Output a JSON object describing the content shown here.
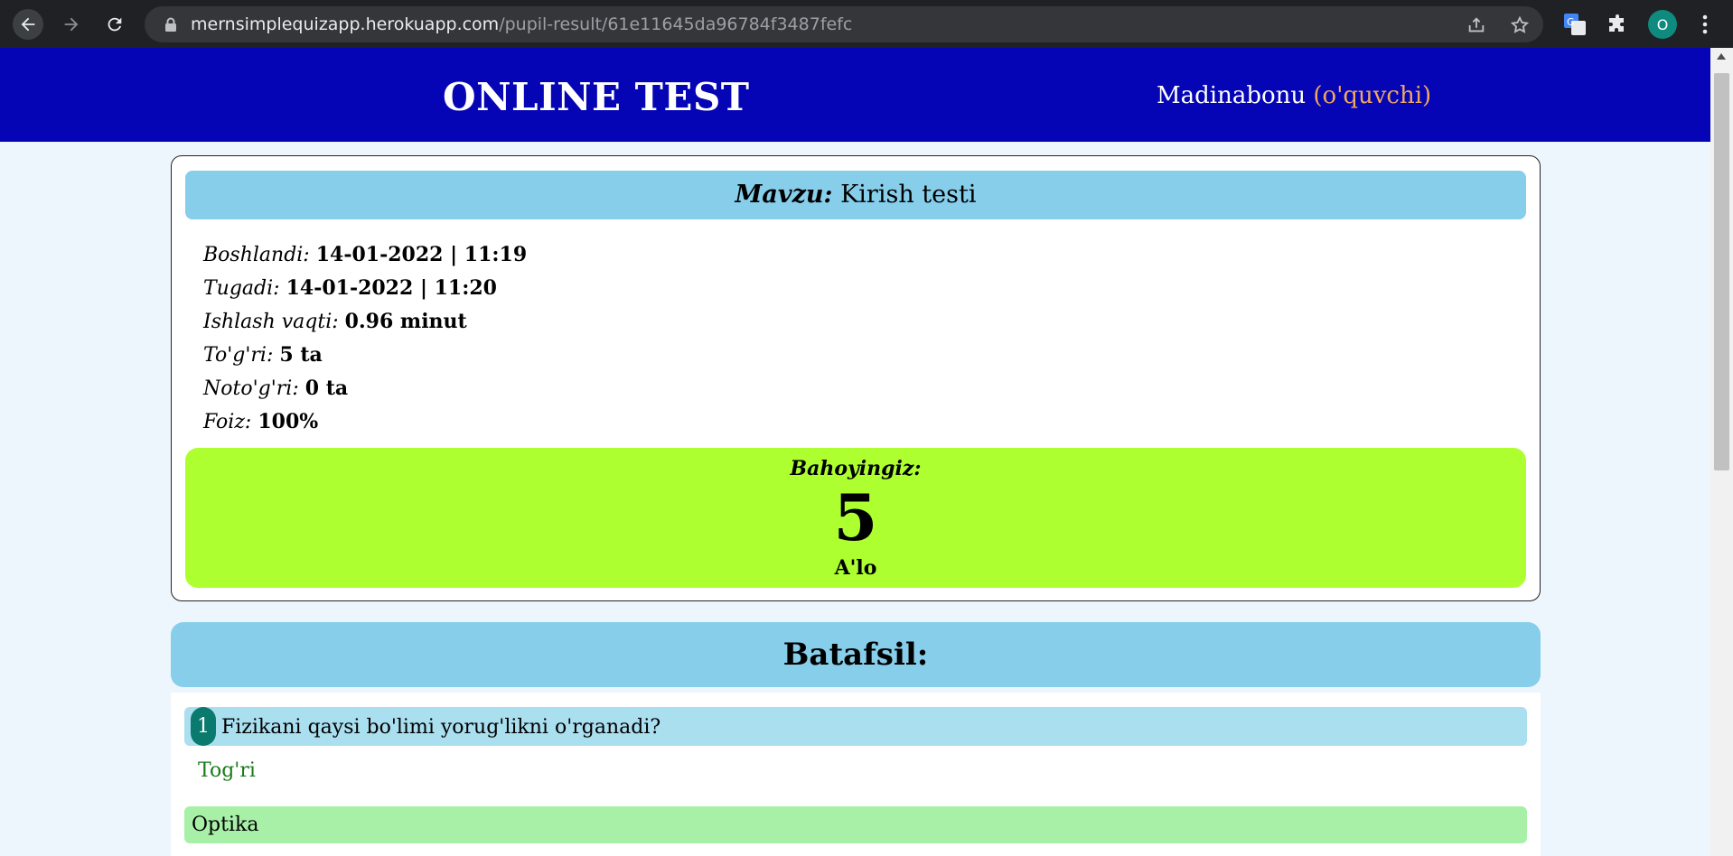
{
  "browser": {
    "url_host": "mernsimplequizapp.herokuapp.com",
    "url_path": "/pupil-result/61e11645da96784f3487fefc",
    "profile_initial": "O"
  },
  "header": {
    "title": "ONLINE TEST",
    "user_name": "Madinabonu",
    "user_role": "(o'quvchi)"
  },
  "result": {
    "topic_label": "Mavzu:",
    "topic_value": "Kirish testi",
    "fields": [
      {
        "label": "Boshlandi:",
        "value": "14-01-2022 | 11:19"
      },
      {
        "label": "Tugadi:",
        "value": "14-01-2022 | 11:20"
      },
      {
        "label": "Ishlash vaqti:",
        "value": "0.96 minut"
      },
      {
        "label": "To'g'ri:",
        "value": "5 ta"
      },
      {
        "label": "Noto'g'ri:",
        "value": "0 ta"
      },
      {
        "label": "Foiz:",
        "value": "100%"
      }
    ],
    "grade_label": "Bahoyingiz:",
    "grade_value": "5",
    "grade_text": "A'lo"
  },
  "details": {
    "heading": "Batafsil:",
    "questions": [
      {
        "number": "1",
        "text": "Fizikani qaysi bo'limi yorug'likni o'rganadi?",
        "status": "Tog'ri",
        "answer": "Optika"
      }
    ]
  },
  "colors": {
    "header_bg": "#0505b5",
    "role_color": "#f0a860",
    "topic_bg": "#87ceeb",
    "grade_bg": "#adff2f",
    "answer_bg": "#a8f0a8",
    "correct_text": "#1a7a1a"
  }
}
